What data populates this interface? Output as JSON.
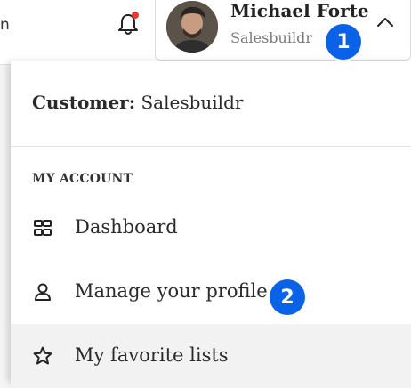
{
  "topbar": {
    "left_fragment": "n",
    "bell_icon": "bell-icon",
    "notification_dot_color": "#e53935"
  },
  "user": {
    "name": "Michael Forte",
    "company": "Salesbuildr",
    "avatar_icon": "avatar",
    "chevron_icon": "chevron-up-icon"
  },
  "badges": {
    "one": "1",
    "two": "2",
    "color": "#0a63e6"
  },
  "dropdown": {
    "customer_label": "Customer:",
    "customer_value": "Salesbuildr",
    "section_title": "MY ACCOUNT",
    "items": [
      {
        "label": "Dashboard",
        "icon": "dashboard-icon"
      },
      {
        "label": "Manage your profile",
        "icon": "user-icon"
      },
      {
        "label": "My favorite lists",
        "icon": "star-icon"
      }
    ]
  }
}
